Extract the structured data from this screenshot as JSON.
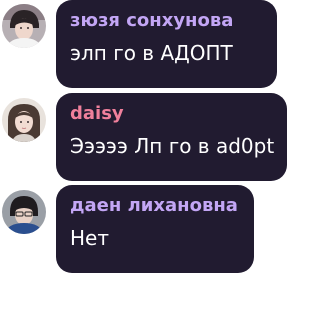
{
  "messages": [
    {
      "author": "зюзя сонхунова",
      "text": "элп го в АДОПТ",
      "name_color": "#c3a6f5",
      "avatar_icon": "user-avatar-photo"
    },
    {
      "author": "daisy",
      "text": "Эээээ Лп го в ad0pt",
      "name_color": "#f0809c",
      "avatar_icon": "user-avatar-photo"
    },
    {
      "author": "даен лихановна",
      "text": "Нет",
      "name_color": "#c3a6f5",
      "avatar_icon": "user-avatar-photo"
    }
  ],
  "colors": {
    "bubble_background": "#211b30",
    "message_text": "#ffffff",
    "page_background": "#ffffff"
  }
}
